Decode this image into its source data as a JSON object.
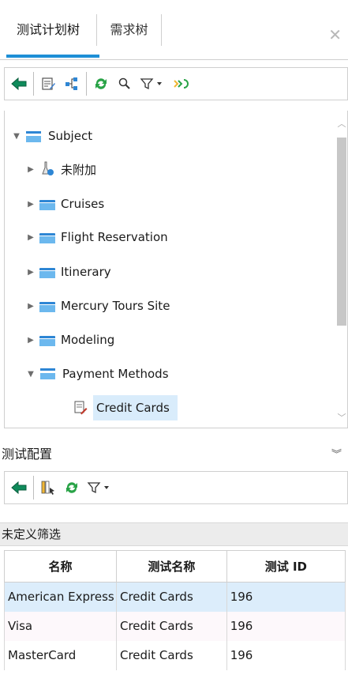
{
  "tabs": [
    {
      "label": "测试计划树",
      "active": true
    },
    {
      "label": "需求树",
      "active": false
    }
  ],
  "accent_color": "#1e8fd6",
  "tree_toolbar_icons": [
    "back-arrow-icon",
    "edit-icon",
    "tree-structure-icon",
    "refresh-icon",
    "search-icon",
    "filter-icon",
    "go-icon"
  ],
  "tree": {
    "root": "Subject",
    "items": [
      {
        "label": "未附加",
        "icon": "flask-icon",
        "expanded": false
      },
      {
        "label": "Cruises",
        "icon": "folder-icon",
        "expanded": false
      },
      {
        "label": "Flight Reservation",
        "icon": "folder-icon",
        "expanded": false
      },
      {
        "label": "Itinerary",
        "icon": "folder-icon",
        "expanded": false
      },
      {
        "label": "Mercury Tours Site",
        "icon": "folder-icon",
        "expanded": false
      },
      {
        "label": "Modeling",
        "icon": "folder-icon",
        "expanded": false
      },
      {
        "label": "Payment Methods",
        "icon": "folder-icon",
        "expanded": true
      }
    ],
    "selected_child": "Credit Cards"
  },
  "config_section": {
    "title": "测试配置",
    "filter_label": "未定义筛选",
    "columns": [
      "名称",
      "测试名称",
      "测试 ID"
    ],
    "rows": [
      {
        "name": "American Express",
        "test_name": "Credit Cards",
        "test_id": "196"
      },
      {
        "name": "Visa",
        "test_name": "Credit Cards",
        "test_id": "196"
      },
      {
        "name": "MasterCard",
        "test_name": "Credit Cards",
        "test_id": "196"
      }
    ]
  }
}
